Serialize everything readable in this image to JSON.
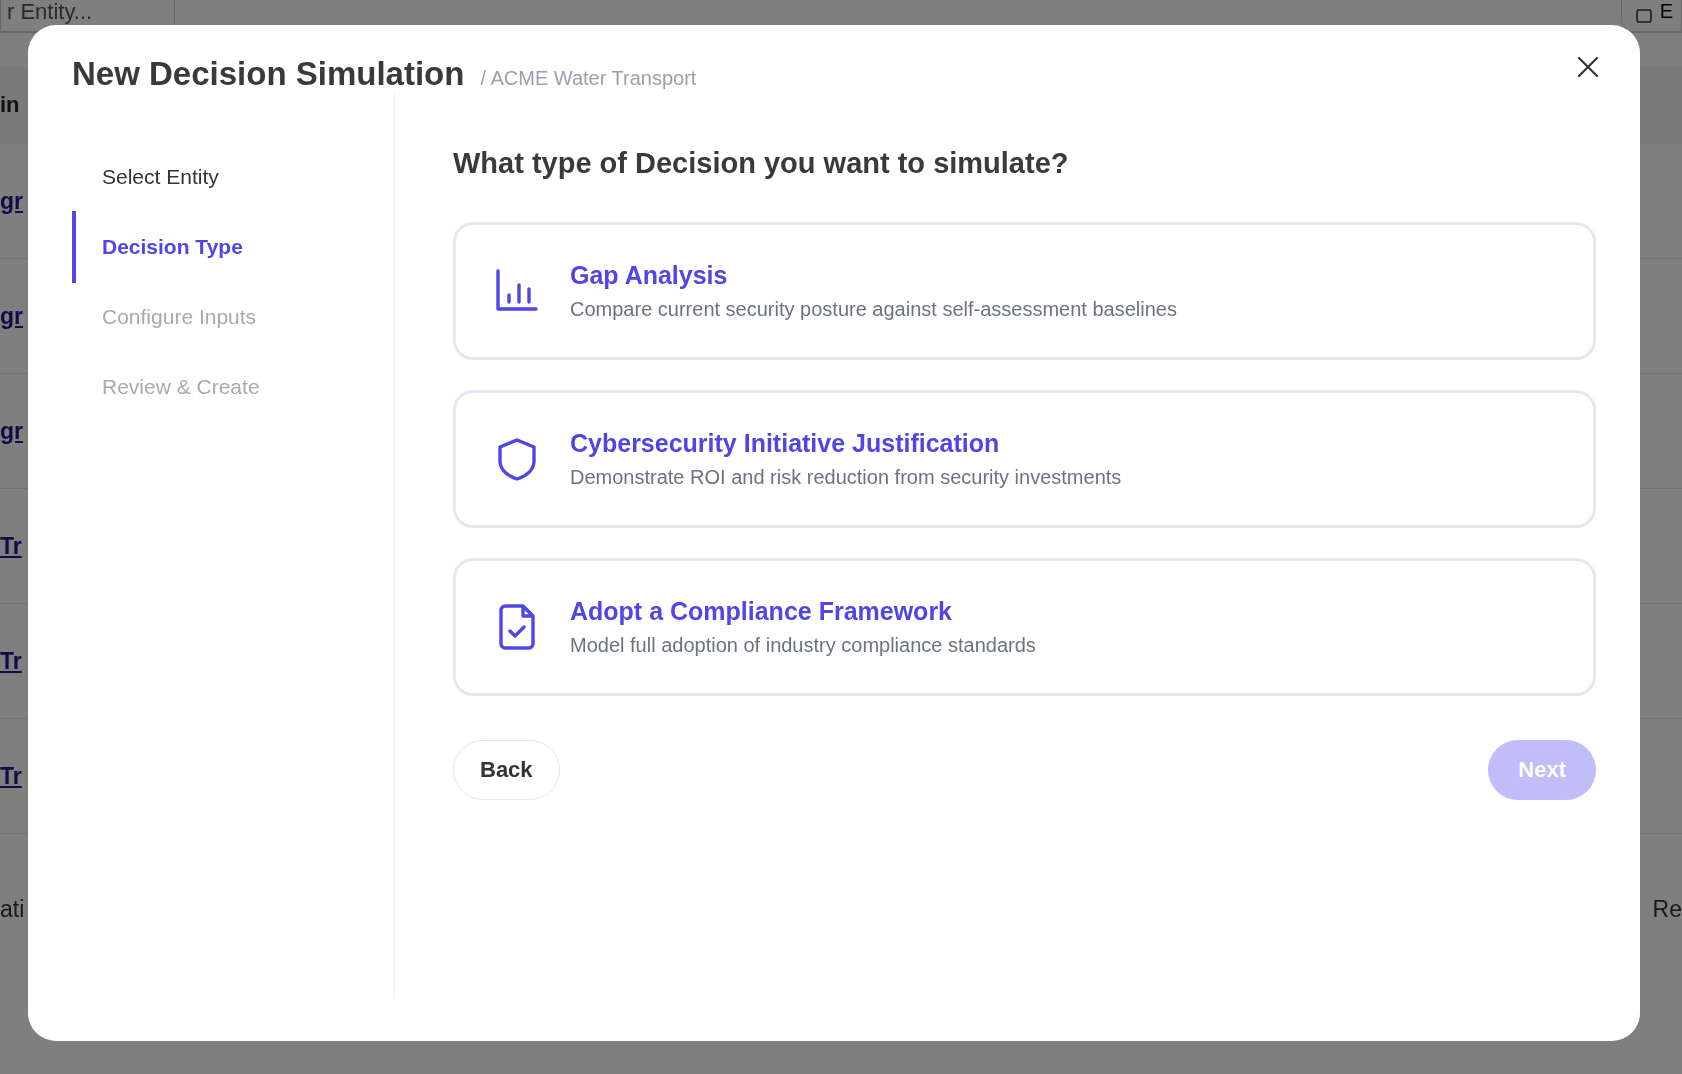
{
  "background": {
    "search": {
      "value": "r Entity..."
    },
    "header_button": {
      "label": "E"
    },
    "header_cell": "in",
    "rows": [
      {
        "link": "gr"
      },
      {
        "link": "gr"
      },
      {
        "link": "gr"
      },
      {
        "link": "Tr"
      },
      {
        "link": "Tr"
      },
      {
        "link": "Tr"
      }
    ],
    "footer": {
      "left": "ati",
      "right": "Re"
    }
  },
  "modal": {
    "title": "New Decision Simulation",
    "subtitle": "/ ACME Water Transport",
    "steps": [
      {
        "label": "Select Entity",
        "selected": false,
        "completed": true
      },
      {
        "label": "Decision Type",
        "selected": true,
        "completed": false
      },
      {
        "label": "Configure Inputs",
        "selected": false,
        "completed": false
      },
      {
        "label": "Review & Create",
        "selected": false,
        "completed": false
      }
    ],
    "question": "What type of Decision you want to simulate?",
    "options": [
      {
        "kind": "chart",
        "title": "Gap Analysis",
        "description": "Compare current security posture against self-assessment baselines"
      },
      {
        "kind": "shield",
        "title": "Cybersecurity Initiative Justification",
        "description": "Demonstrate ROI and risk reduction from security investments"
      },
      {
        "kind": "document",
        "title": "Adopt a Compliance Framework",
        "description": "Model full adoption of industry compliance standards"
      }
    ],
    "back_button": {
      "label": "Back"
    },
    "next_button": {
      "label": "Next",
      "disabled": true
    }
  }
}
